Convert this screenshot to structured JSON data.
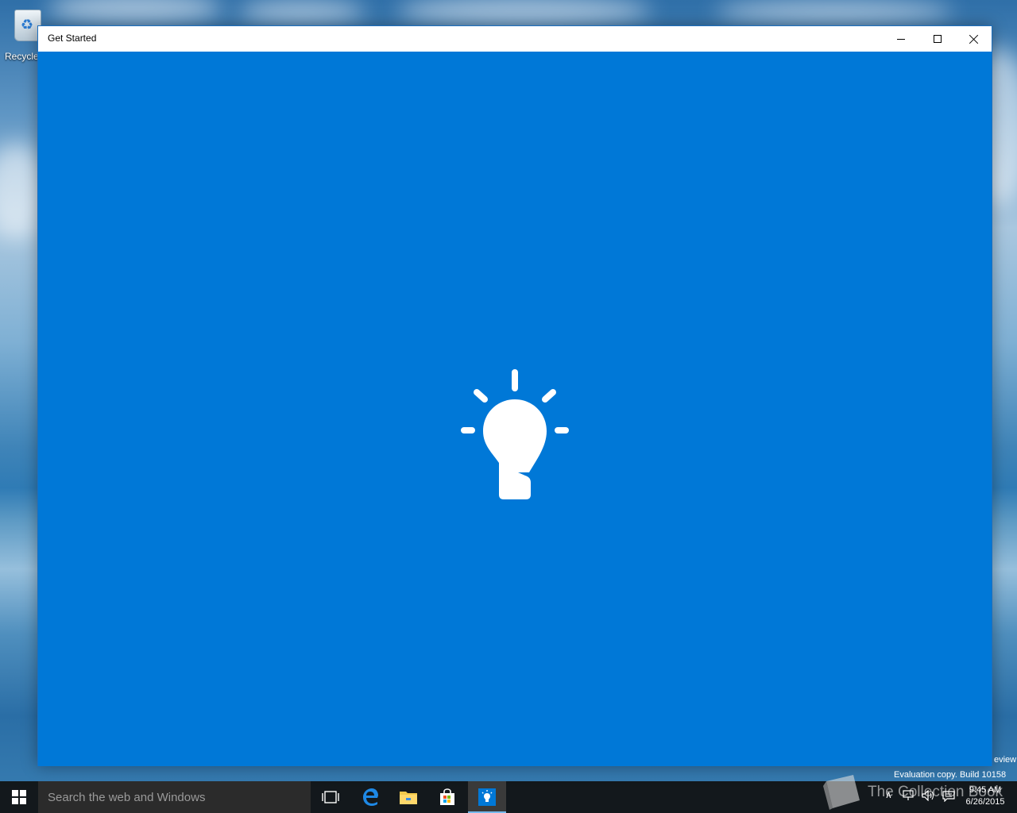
{
  "desktop": {
    "recycle_bin_label": "Recycle",
    "watermark_line1": "eview",
    "watermark_line2": "Evaluation copy. Build 10158"
  },
  "window": {
    "title": "Get Started",
    "controls": [
      "minimize",
      "maximize",
      "close"
    ],
    "content_icon": "lightbulb-icon",
    "accent": "#0078d7"
  },
  "taskbar": {
    "search_placeholder": "Search the web and Windows",
    "pinned": [
      "task-view-icon",
      "edge-icon",
      "file-explorer-icon",
      "store-icon",
      "get-started-icon"
    ],
    "active": "get-started-icon",
    "overlay_logo_text": "The Collection Book",
    "clock_time": "9:45 AM",
    "clock_date": "6/26/2015"
  }
}
